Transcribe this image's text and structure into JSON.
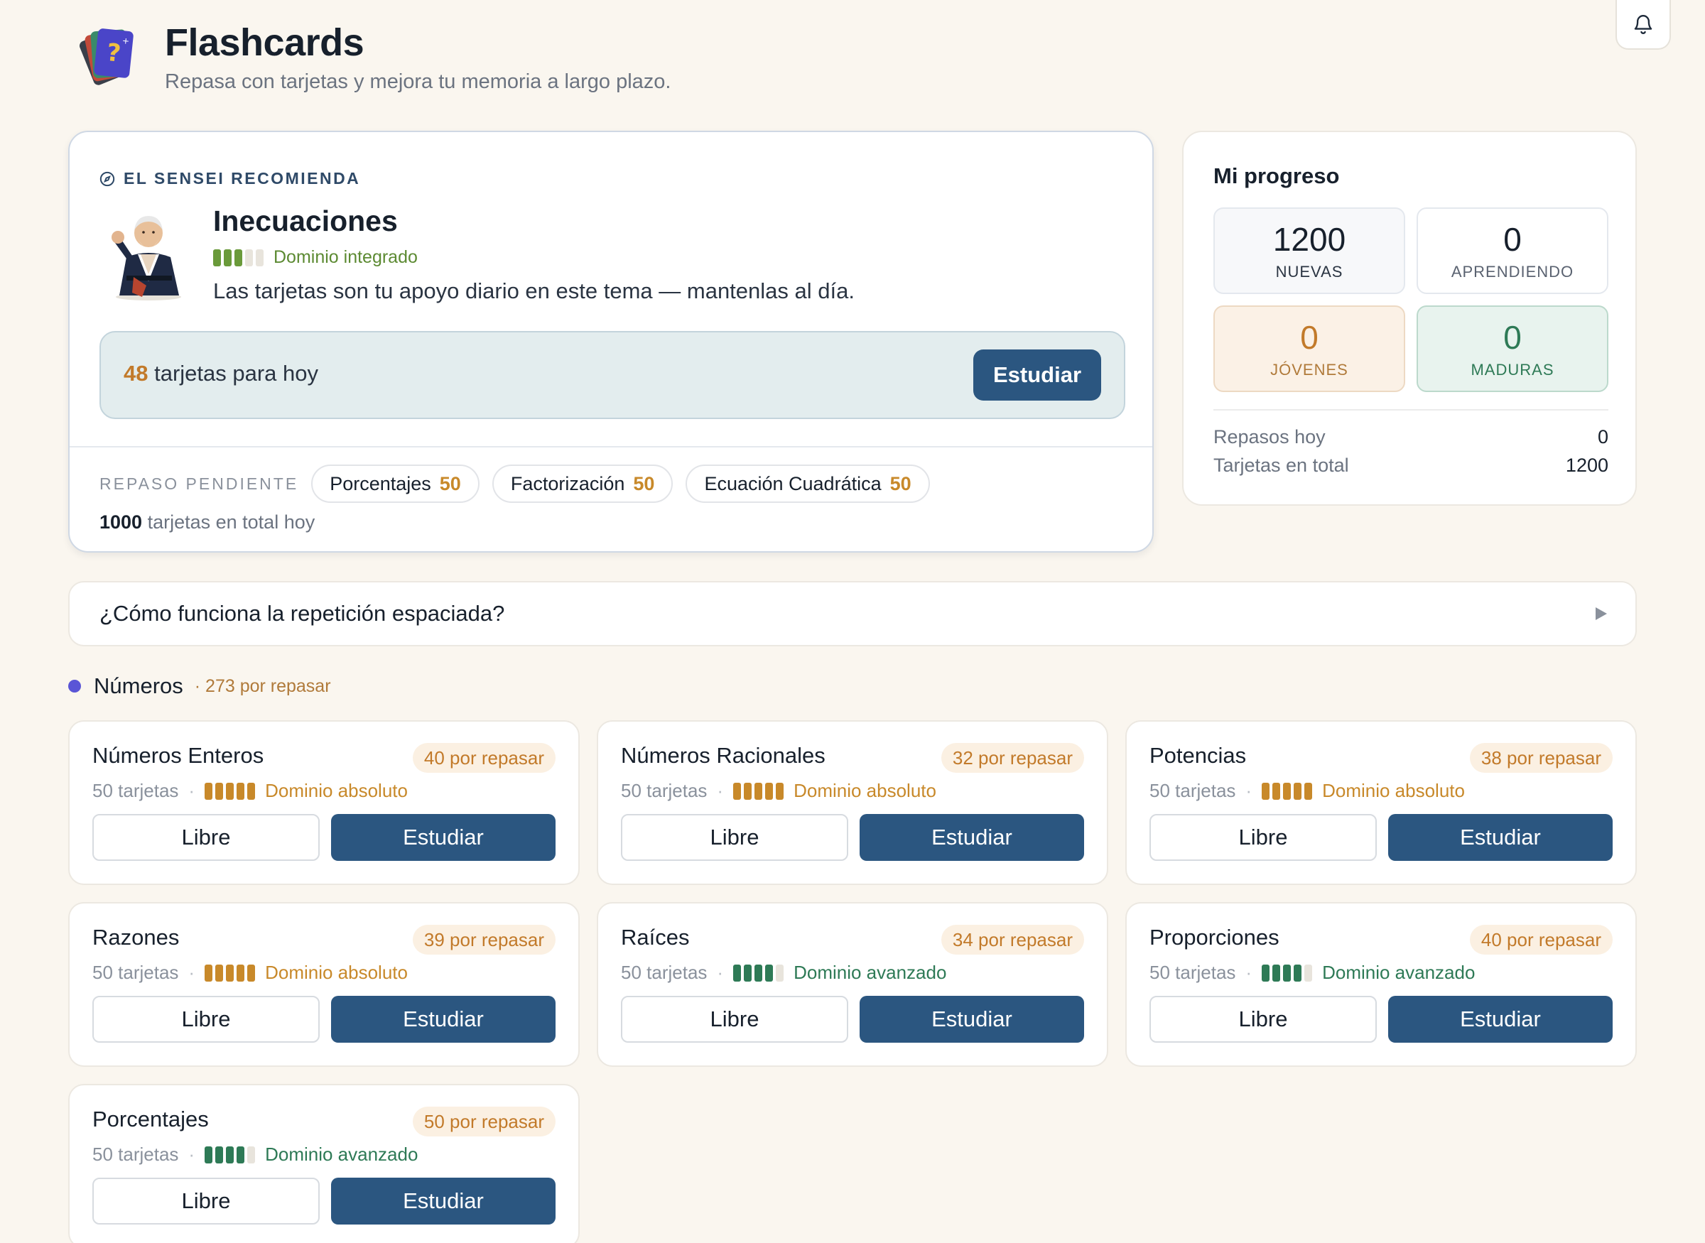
{
  "header": {
    "title": "Flashcards",
    "subtitle": "Repasa con tarjetas y mejora tu memoria a largo plazo."
  },
  "recommendation": {
    "label": "EL SENSEI RECOMIENDA",
    "topic": "Inecuaciones",
    "mastery": "Dominio integrado",
    "mastery_level": 3,
    "mastery_color": "#6a9a3a",
    "description": "Las tarjetas son tu apoyo diario en este tema — mantenlas al día.",
    "today_count": "48",
    "today_text": " tarjetas para hoy",
    "study_label": "Estudiar",
    "pending_label": "REPASO PENDIENTE",
    "pending": [
      {
        "name": "Porcentajes",
        "count": "50"
      },
      {
        "name": "Factorización",
        "count": "50"
      },
      {
        "name": "Ecuación Cuadrática",
        "count": "50"
      }
    ],
    "total_count": "1000",
    "total_text": " tarjetas en total hoy"
  },
  "progress": {
    "title": "Mi progreso",
    "stats": {
      "nuevas": {
        "value": "1200",
        "label": "NUEVAS"
      },
      "aprendiendo": {
        "value": "0",
        "label": "APRENDIENDO"
      },
      "jovenes": {
        "value": "0",
        "label": "JÓVENES"
      },
      "maduras": {
        "value": "0",
        "label": "MADURAS"
      }
    },
    "reviews_today_label": "Repasos hoy",
    "reviews_today_value": "0",
    "total_cards_label": "Tarjetas en total",
    "total_cards_value": "1200"
  },
  "accordion": {
    "label": "¿Cómo funciona la repetición espaciada?"
  },
  "section": {
    "title": "Números",
    "count": "· 273 por repasar"
  },
  "colors": {
    "gold": "#c8892a",
    "green": "#2e7a56",
    "primary": "#2b5680",
    "accent_dot": "#5a55d6"
  },
  "decks": [
    {
      "name": "Números Enteros",
      "due": "40 por repasar",
      "cards": "50 tarjetas",
      "level": "Dominio absoluto",
      "level_value": 5,
      "color": "#c8892a",
      "libre": "Libre",
      "study": "Estudiar"
    },
    {
      "name": "Números Racionales",
      "due": "32 por repasar",
      "cards": "50 tarjetas",
      "level": "Dominio absoluto",
      "level_value": 5,
      "color": "#c8892a",
      "libre": "Libre",
      "study": "Estudiar"
    },
    {
      "name": "Potencias",
      "due": "38 por repasar",
      "cards": "50 tarjetas",
      "level": "Dominio absoluto",
      "level_value": 5,
      "color": "#c8892a",
      "libre": "Libre",
      "study": "Estudiar"
    },
    {
      "name": "Razones",
      "due": "39 por repasar",
      "cards": "50 tarjetas",
      "level": "Dominio absoluto",
      "level_value": 5,
      "color": "#c8892a",
      "libre": "Libre",
      "study": "Estudiar"
    },
    {
      "name": "Raíces",
      "due": "34 por repasar",
      "cards": "50 tarjetas",
      "level": "Dominio avanzado",
      "level_value": 4,
      "color": "#2e7a56",
      "libre": "Libre",
      "study": "Estudiar"
    },
    {
      "name": "Proporciones",
      "due": "40 por repasar",
      "cards": "50 tarjetas",
      "level": "Dominio avanzado",
      "level_value": 4,
      "color": "#2e7a56",
      "libre": "Libre",
      "study": "Estudiar"
    },
    {
      "name": "Porcentajes",
      "due": "50 por repasar",
      "cards": "50 tarjetas",
      "level": "Dominio avanzado",
      "level_value": 4,
      "color": "#2e7a56",
      "libre": "Libre",
      "study": "Estudiar"
    }
  ]
}
